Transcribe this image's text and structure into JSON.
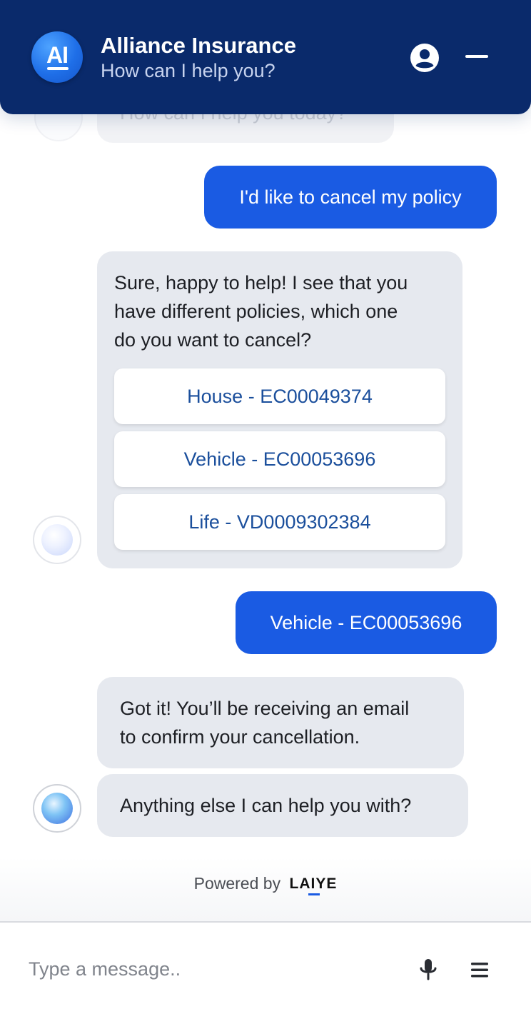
{
  "header": {
    "logo_text": "AI",
    "title": "Alliance Insurance",
    "subtitle": "How can I help you?",
    "icons": {
      "profile": "user-circle-icon",
      "minimize": "minimize-icon"
    }
  },
  "chat": {
    "faded_message": "How can I help you today?",
    "messages": [
      {
        "from": "user",
        "text": "I'd like to cancel my policy"
      },
      {
        "from": "bot",
        "text": "Sure, happy to help! I see that you have different policies, which one do you want to cancel?",
        "lines": [
          "Sure, happy to help! I see that you",
          "have different policies, which one",
          "do you want to cancel?"
        ],
        "options": [
          "House - EC00049374",
          "Vehicle - EC00053696",
          "Life - VD0009302384"
        ]
      },
      {
        "from": "user",
        "text": "Vehicle - EC00053696"
      },
      {
        "from": "bot",
        "text": "Got it! You’ll be receiving an email to confirm your cancellation.",
        "lines": [
          "Got it! You’ll be receiving an email",
          "to confirm your cancellation."
        ]
      },
      {
        "from": "bot",
        "text": "Anything else I can help you with?"
      }
    ]
  },
  "footer": {
    "powered_by": "Powered by",
    "brand": "LAIYE"
  },
  "composer": {
    "placeholder": "Type a message..",
    "icons": {
      "mic": "microphone-icon",
      "menu": "menu-icon"
    }
  },
  "colors": {
    "header_bg": "#0a2a6b",
    "user_bubble": "#1a5be3",
    "bot_bubble": "#e6e9ef",
    "option_text": "#1b4f9c"
  }
}
